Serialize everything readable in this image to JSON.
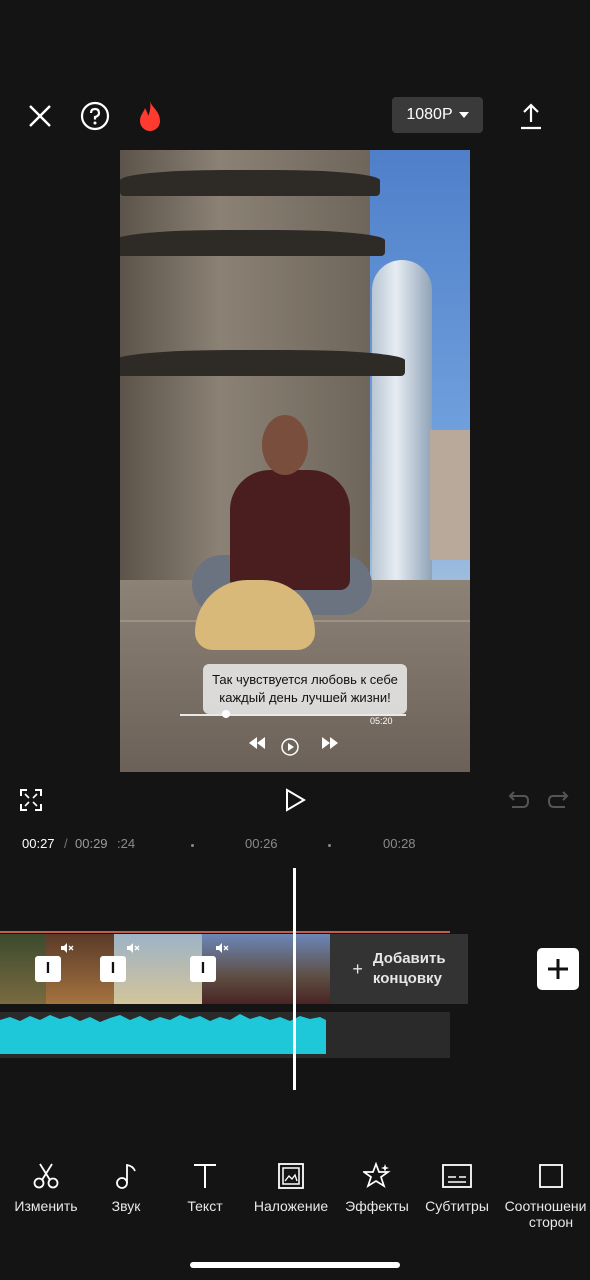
{
  "top_bar": {
    "close_icon": "close-icon",
    "help_icon": "help-icon",
    "pro_icon": "flame-icon",
    "resolution": "1080P",
    "export_icon": "upload-icon",
    "accent_color": "#ff3b30"
  },
  "preview": {
    "caption_line1": "Так чувствуется любовь к себе",
    "caption_line2": "каждый день лучшей жизни!",
    "embedded_time": "05:20"
  },
  "playback": {
    "current_time": "00:27",
    "separator": "/",
    "total_time": "00:29"
  },
  "ruler": {
    "labels": [
      ":24",
      "00:26",
      "00:28"
    ]
  },
  "timeline": {
    "add_ending_line1": "Добавить",
    "add_ending_line2": "концовку",
    "add_ending_plus": "+",
    "split_marker": "I",
    "audio_color": "#1ec8d8"
  },
  "toolbar": {
    "items": [
      {
        "label": "Изменить",
        "icon": "scissors-icon"
      },
      {
        "label": "Звук",
        "icon": "music-note-icon"
      },
      {
        "label": "Текст",
        "icon": "text-icon"
      },
      {
        "label": "Наложение",
        "icon": "overlay-icon"
      },
      {
        "label": "Эффекты",
        "icon": "effects-star-icon"
      },
      {
        "label": "Субтитры",
        "icon": "subtitles-icon"
      },
      {
        "label_line1": "Соотношени",
        "label_line2": "сторон",
        "icon": "aspect-ratio-icon"
      }
    ]
  }
}
